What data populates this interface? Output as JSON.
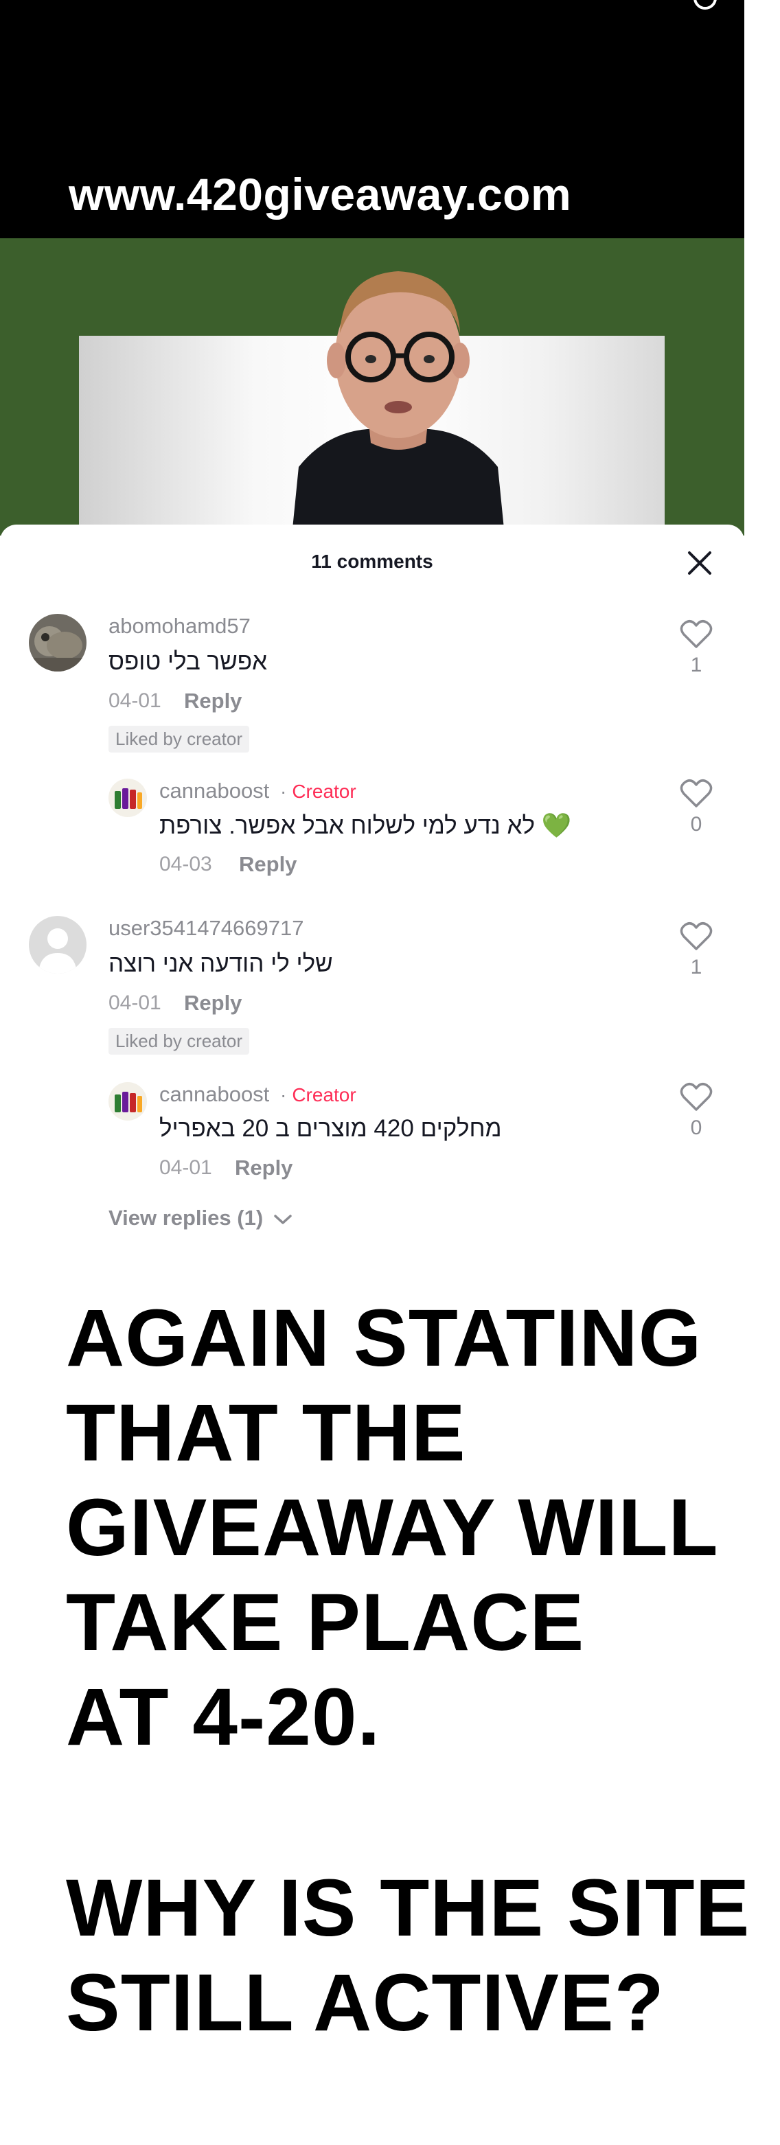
{
  "video": {
    "url_text": "www.420giveaway.com"
  },
  "comments_panel": {
    "count_label": "11 comments",
    "close_icon": "close-icon",
    "comments": [
      {
        "username": "abomohamd57",
        "text": "אפשר בלי טופס",
        "date": "04-01",
        "reply_label": "Reply",
        "badge": "Liked by creator",
        "likes": "1"
      },
      {
        "username": "cannaboost",
        "creator_label": "Creator",
        "text": "לא נדע למי לשלוח אבל אפשר. צורפת 💚",
        "date": "04-03",
        "reply_label": "Reply",
        "likes": "0"
      },
      {
        "username": "user3541474669717",
        "text": "שלי לי הודעה אני רוצה",
        "date": "04-01",
        "reply_label": "Reply",
        "badge": "Liked by creator",
        "likes": "1"
      },
      {
        "username": "cannaboost",
        "creator_label": "Creator",
        "text": "מחלקים 420 מוצרים ב 20 באפריל",
        "date": "04-01",
        "reply_label": "Reply",
        "likes": "0"
      }
    ],
    "view_replies_label": "View replies (1)",
    "colors": {
      "creator": "#fe2c55",
      "secondary_text": "#8a8b91",
      "green_bg": "#3c5f2c"
    }
  },
  "caption": {
    "lines_block1": [
      "AGAIN STATING",
      "THAT THE",
      "GIVEAWAY WILL",
      "TAKE PLACE",
      "AT 4-20."
    ],
    "lines_block2": [
      "WHY IS THE SITE",
      "STILL ACTIVE?"
    ]
  }
}
